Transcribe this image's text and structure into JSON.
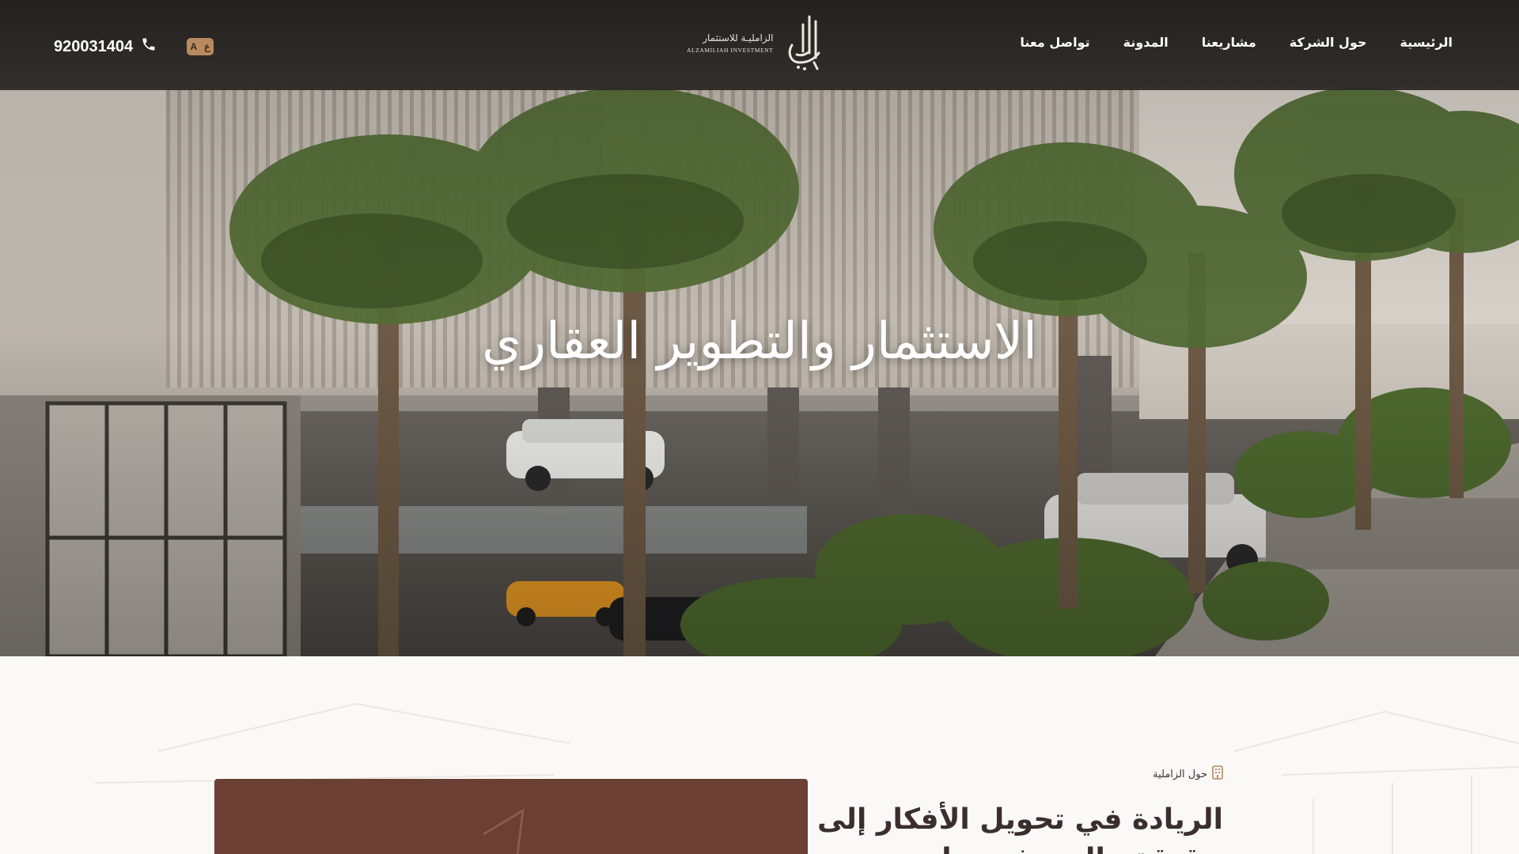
{
  "header": {
    "phone": "920031404",
    "language_toggle": {
      "label_a": "A",
      "label_b": "ع"
    },
    "logo": {
      "arabic": "الزامليـة للاستثمار",
      "english": "ALZAMILIAH INVESTMENT"
    },
    "nav": [
      {
        "label": "الرئيسية"
      },
      {
        "label": "حول الشركة"
      },
      {
        "label": "مشاريعنا"
      },
      {
        "label": "المدونة"
      },
      {
        "label": "تواصل معنا"
      }
    ],
    "icons": {
      "phone": "phone-icon",
      "lang": "language-toggle-icon"
    }
  },
  "hero": {
    "title": "الاستثمار والتطوير العقاري",
    "image": "building-courtyard-with-palm-trees-and-cars"
  },
  "about": {
    "label": "حول الزاملية",
    "heading": "الريادة في تحويل الأفكار إلى حقيقة والبدء في بناء",
    "accent_color": "#6b3f33"
  },
  "colors": {
    "header_bg": "#2a2724",
    "accent_gold": "#b88a5e",
    "page_bg": "#faf9f7",
    "heading_text": "#3a2f2c"
  }
}
